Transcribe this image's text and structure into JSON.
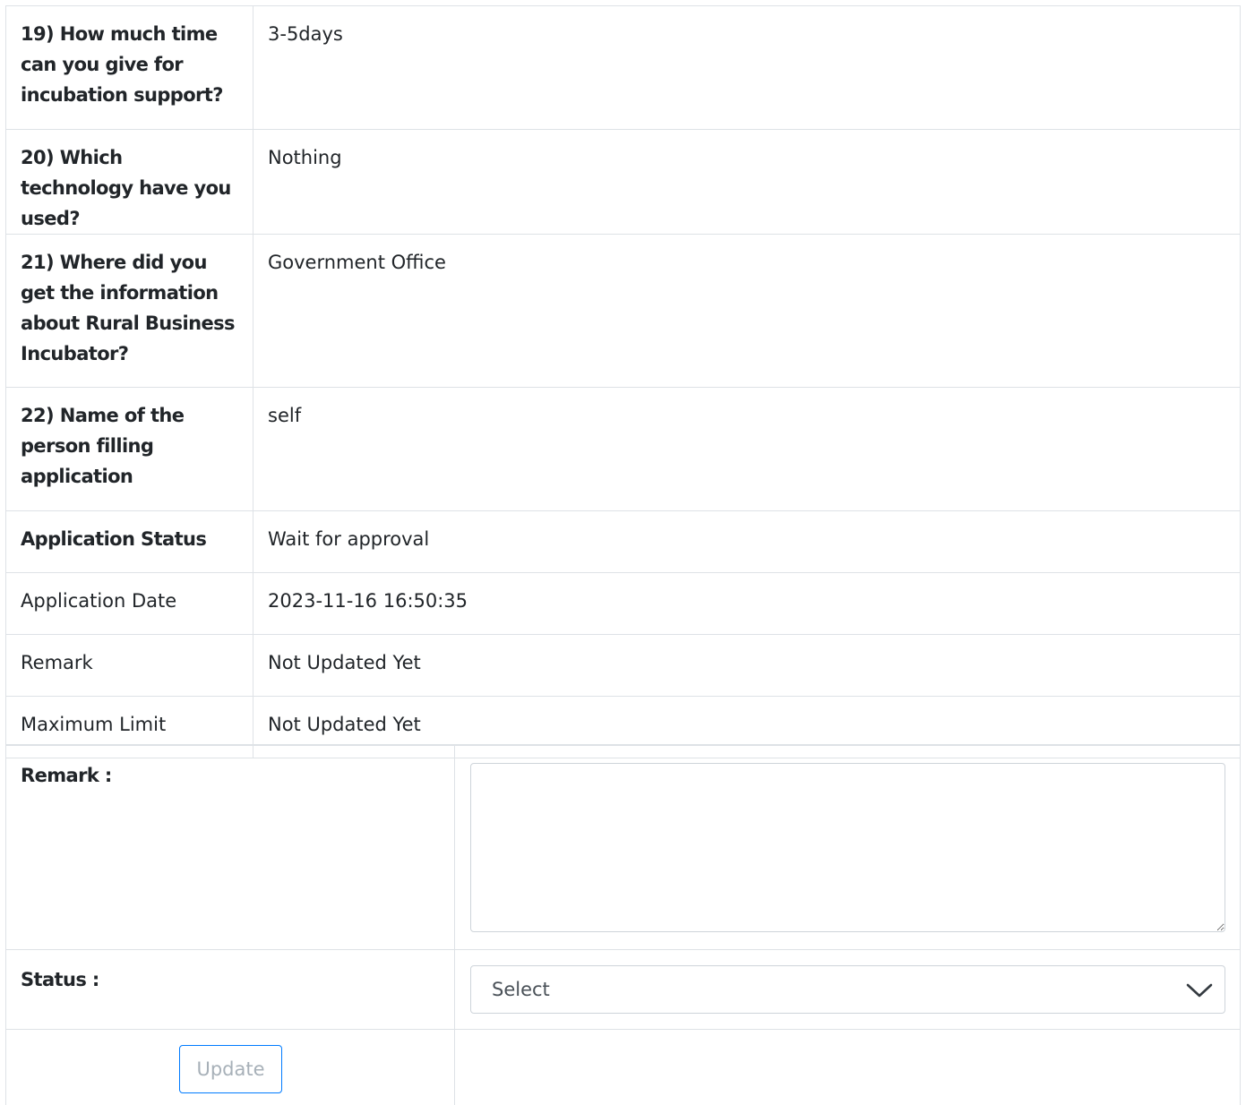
{
  "details": [
    {
      "question": "19) How much time can you give for incubation support?",
      "answer": "3-5days",
      "bold": true
    },
    {
      "question": "20) Which technology have you used?",
      "answer": "Nothing",
      "bold": true
    },
    {
      "question": "21) Where did you get the information about Rural Business Incubator?",
      "answer": "Government Office",
      "bold": true
    },
    {
      "question": "22) Name of the person filling application",
      "answer": "self",
      "bold": true
    },
    {
      "question": "Application Status",
      "answer": "Wait for approval",
      "bold": true
    },
    {
      "question": "Application Date",
      "answer": "2023-11-16 16:50:35",
      "bold": false
    },
    {
      "question": "Remark",
      "answer": "Not Updated Yet",
      "bold": false
    },
    {
      "question": "Maximum Limit",
      "answer": "Not Updated Yet",
      "bold": false
    }
  ],
  "form": {
    "remark_label": "Remark :",
    "remark_value": "",
    "status_label": "Status :",
    "status_selected": "Select",
    "update_label": "Update"
  },
  "colors": {
    "border": "#dee2e6",
    "button_border": "#007bff",
    "button_text": "#a7b0b8"
  }
}
